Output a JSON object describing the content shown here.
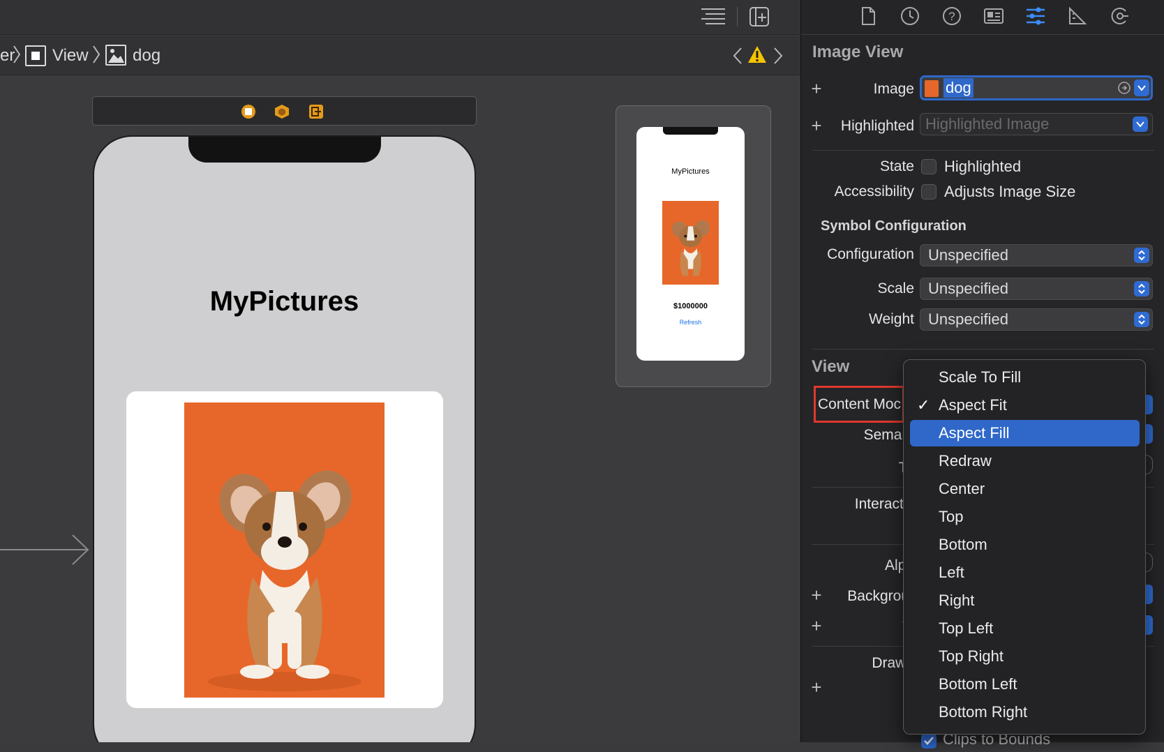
{
  "breadcrumb": {
    "partial": "er",
    "view": "View",
    "dog": "dog"
  },
  "canvas": {
    "app_title": "MyPictures",
    "preview_title": "MyPictures",
    "preview_price": "$1000000",
    "preview_button": "Refresh"
  },
  "inspector": {
    "section_title": "Image View",
    "image_label": "Image",
    "image_value": "dog",
    "highlighted_label": "Highlighted",
    "highlighted_placeholder": "Highlighted Image",
    "state_label": "State",
    "state_checkbox": "Highlighted",
    "accessibility_label": "Accessibility",
    "accessibility_checkbox": "Adjusts Image Size",
    "symbol_config_title": "Symbol Configuration",
    "configuration_label": "Configuration",
    "configuration_value": "Unspecified",
    "scale_label": "Scale",
    "scale_value": "Unspecified",
    "weight_label": "Weight",
    "weight_value": "Unspecified",
    "view_title": "View",
    "content_mode_label": "Content Moc",
    "semantic_label": "Semant",
    "tag_label": "Ta",
    "interaction_label": "Interactic",
    "alpha_label": "Alph",
    "background_label": "Backgrour",
    "tint_label": "Ti",
    "drawing_label": "Drawir",
    "clips_label": "Clips to Bounds"
  },
  "content_mode_menu": {
    "items": [
      "Scale To Fill",
      "Aspect Fit",
      "Aspect Fill",
      "Redraw",
      "Center",
      "Top",
      "Bottom",
      "Left",
      "Right",
      "Top Left",
      "Top Right",
      "Bottom Left",
      "Bottom Right"
    ],
    "checked": "Aspect Fit",
    "highlighted": "Aspect Fill"
  },
  "colors": {
    "accent": "#2f68c9",
    "warning": "#f5c400",
    "highlight_box": "#e0382d",
    "photo_bg": "#e7672a"
  }
}
